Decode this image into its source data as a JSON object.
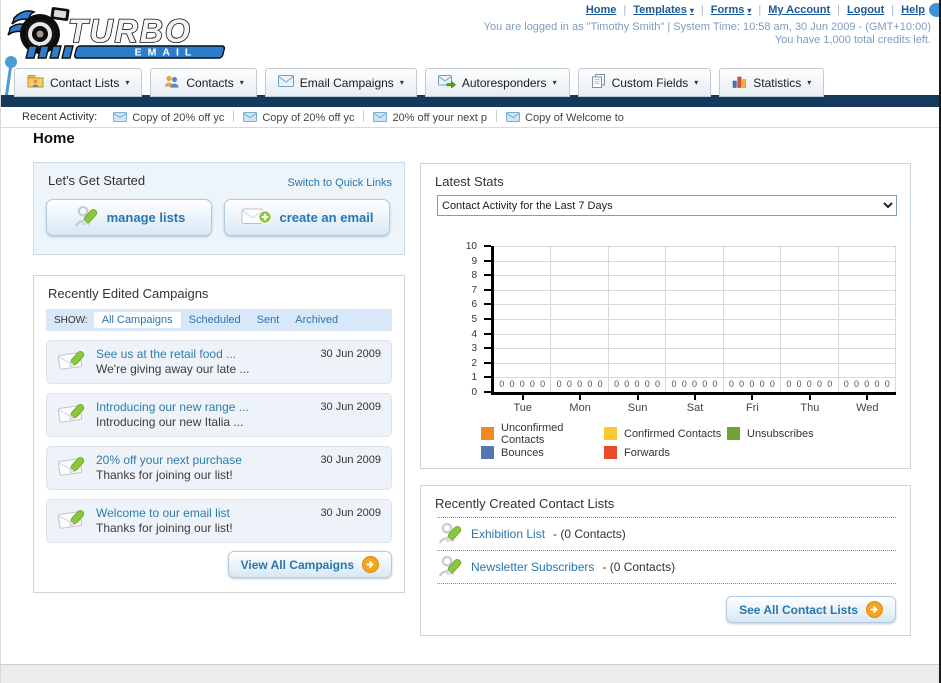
{
  "header": {
    "logo_title": "TURBO",
    "logo_subtitle": "EMAIL",
    "nav_links": [
      {
        "label": "Home",
        "dropdown": false
      },
      {
        "label": "Templates",
        "dropdown": true
      },
      {
        "label": "Forms",
        "dropdown": true
      },
      {
        "label": "My Account",
        "dropdown": false
      },
      {
        "label": "Logout",
        "dropdown": false
      },
      {
        "label": "Help",
        "dropdown": false
      }
    ],
    "login_info": "You are logged in as \"Timothy Smith\" | System Time: 10:58 am, 30 Jun 2009 - (GMT+10:00)",
    "credits_info": "You have 1,000 total credits left."
  },
  "nav_tabs": [
    {
      "label": "Contact Lists",
      "icon": "contact-lists-folder-icon"
    },
    {
      "label": "Contacts",
      "icon": "contacts-people-icon"
    },
    {
      "label": "Email Campaigns",
      "icon": "envelope-icon"
    },
    {
      "label": "Autoresponders",
      "icon": "autoresponder-envelope-icon"
    },
    {
      "label": "Custom Fields",
      "icon": "custom-fields-pages-icon"
    },
    {
      "label": "Statistics",
      "icon": "statistics-bars-icon"
    }
  ],
  "recent_activity": {
    "label": "Recent Activity:",
    "items": [
      "Copy of 20% off yc",
      "Copy of 20% off yc",
      "20% off your next p",
      "Copy of Welcome to"
    ]
  },
  "page_title": "Home",
  "get_started": {
    "title": "Let's Get Started",
    "switch_link": "Switch to Quick Links",
    "buttons": [
      {
        "label": "manage lists",
        "icon": "person-pencil-icon"
      },
      {
        "label": "create an email",
        "icon": "envelope-plus-icon"
      }
    ]
  },
  "campaigns": {
    "title": "Recently Edited Campaigns",
    "show_label": "SHOW:",
    "filters": [
      "All Campaigns",
      "Scheduled",
      "Sent",
      "Archived"
    ],
    "active_filter": "All Campaigns",
    "items": [
      {
        "title": "See us at the retail food ...",
        "subtitle": "We're giving away our late ...",
        "date": "30 Jun 2009"
      },
      {
        "title": "Introducing our new range ...",
        "subtitle": "Introducing our new Italia ...",
        "date": "30 Jun 2009"
      },
      {
        "title": "20% off your next purchase",
        "subtitle": "Thanks for joining our list!",
        "date": "30 Jun 2009"
      },
      {
        "title": "Welcome to our email list",
        "subtitle": "Thanks for joining our list!",
        "date": "30 Jun 2009"
      }
    ],
    "view_all_label": "View All Campaigns"
  },
  "latest_stats": {
    "title": "Latest Stats",
    "dropdown_value": "Contact Activity for the Last 7 Days"
  },
  "chart_data": {
    "type": "bar",
    "title": "Contact Activity for the Last 7 Days",
    "categories": [
      "Tue",
      "Mon",
      "Sun",
      "Sat",
      "Fri",
      "Thu",
      "Wed"
    ],
    "series": [
      {
        "name": "Unconfirmed Contacts",
        "color": "#f18b21",
        "values": [
          0,
          0,
          0,
          0,
          0,
          0,
          0
        ]
      },
      {
        "name": "Confirmed Contacts",
        "color": "#fbc92f",
        "values": [
          0,
          0,
          0,
          0,
          0,
          0,
          0
        ]
      },
      {
        "name": "Unsubscribes",
        "color": "#71a330",
        "values": [
          0,
          0,
          0,
          0,
          0,
          0,
          0
        ]
      },
      {
        "name": "Bounces",
        "color": "#5575b5",
        "values": [
          0,
          0,
          0,
          0,
          0,
          0,
          0
        ]
      },
      {
        "name": "Forwards",
        "color": "#e64c2c",
        "values": [
          0,
          0,
          0,
          0,
          0,
          0,
          0
        ]
      }
    ],
    "ylim": [
      0,
      10
    ],
    "yticks": [
      0,
      1,
      2,
      3,
      4,
      5,
      6,
      7,
      8,
      9,
      10
    ],
    "grid": true,
    "legend_position": "bottom",
    "value_labels_shown": true
  },
  "contact_lists": {
    "title": "Recently Created Contact Lists",
    "items": [
      {
        "name": "Exhibition List",
        "count": "(0 Contacts)"
      },
      {
        "name": "Newsletter Subscribers",
        "count": "(0 Contacts)"
      }
    ],
    "see_all_label": "See All Contact Lists"
  },
  "colors": {
    "navy_bar": "#16395e",
    "link_blue": "#2a76ae",
    "nav_link_blue": "#1b5a96",
    "login_text": "#7d9cc0",
    "panel_border": "#ccd6df",
    "row_bg": "#eef3f9",
    "filter_bg": "#d9e8f8",
    "logo_blue": "#2e7ccc",
    "arrow_orange": "#f5a41f"
  }
}
